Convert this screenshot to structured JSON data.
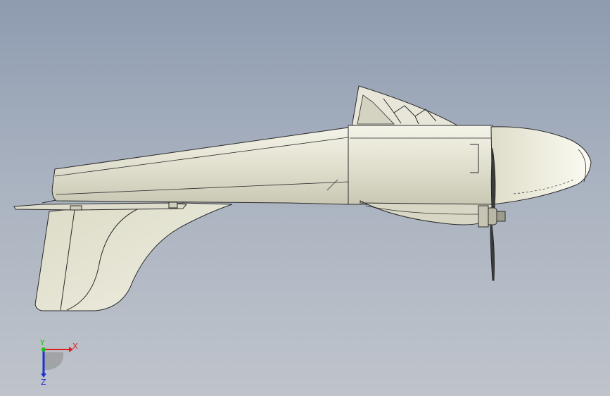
{
  "triad": {
    "x_label": "X",
    "y_label": "Y",
    "z_label": "Z",
    "colors": {
      "x": "#e02020",
      "y": "#1fbf1f",
      "z": "#2030d0"
    }
  },
  "colors": {
    "background_top": "#8e9bb0",
    "background_bottom": "#bfc4cb",
    "body_fill": "#e6e5d6",
    "edge": "#2b2b2b"
  }
}
